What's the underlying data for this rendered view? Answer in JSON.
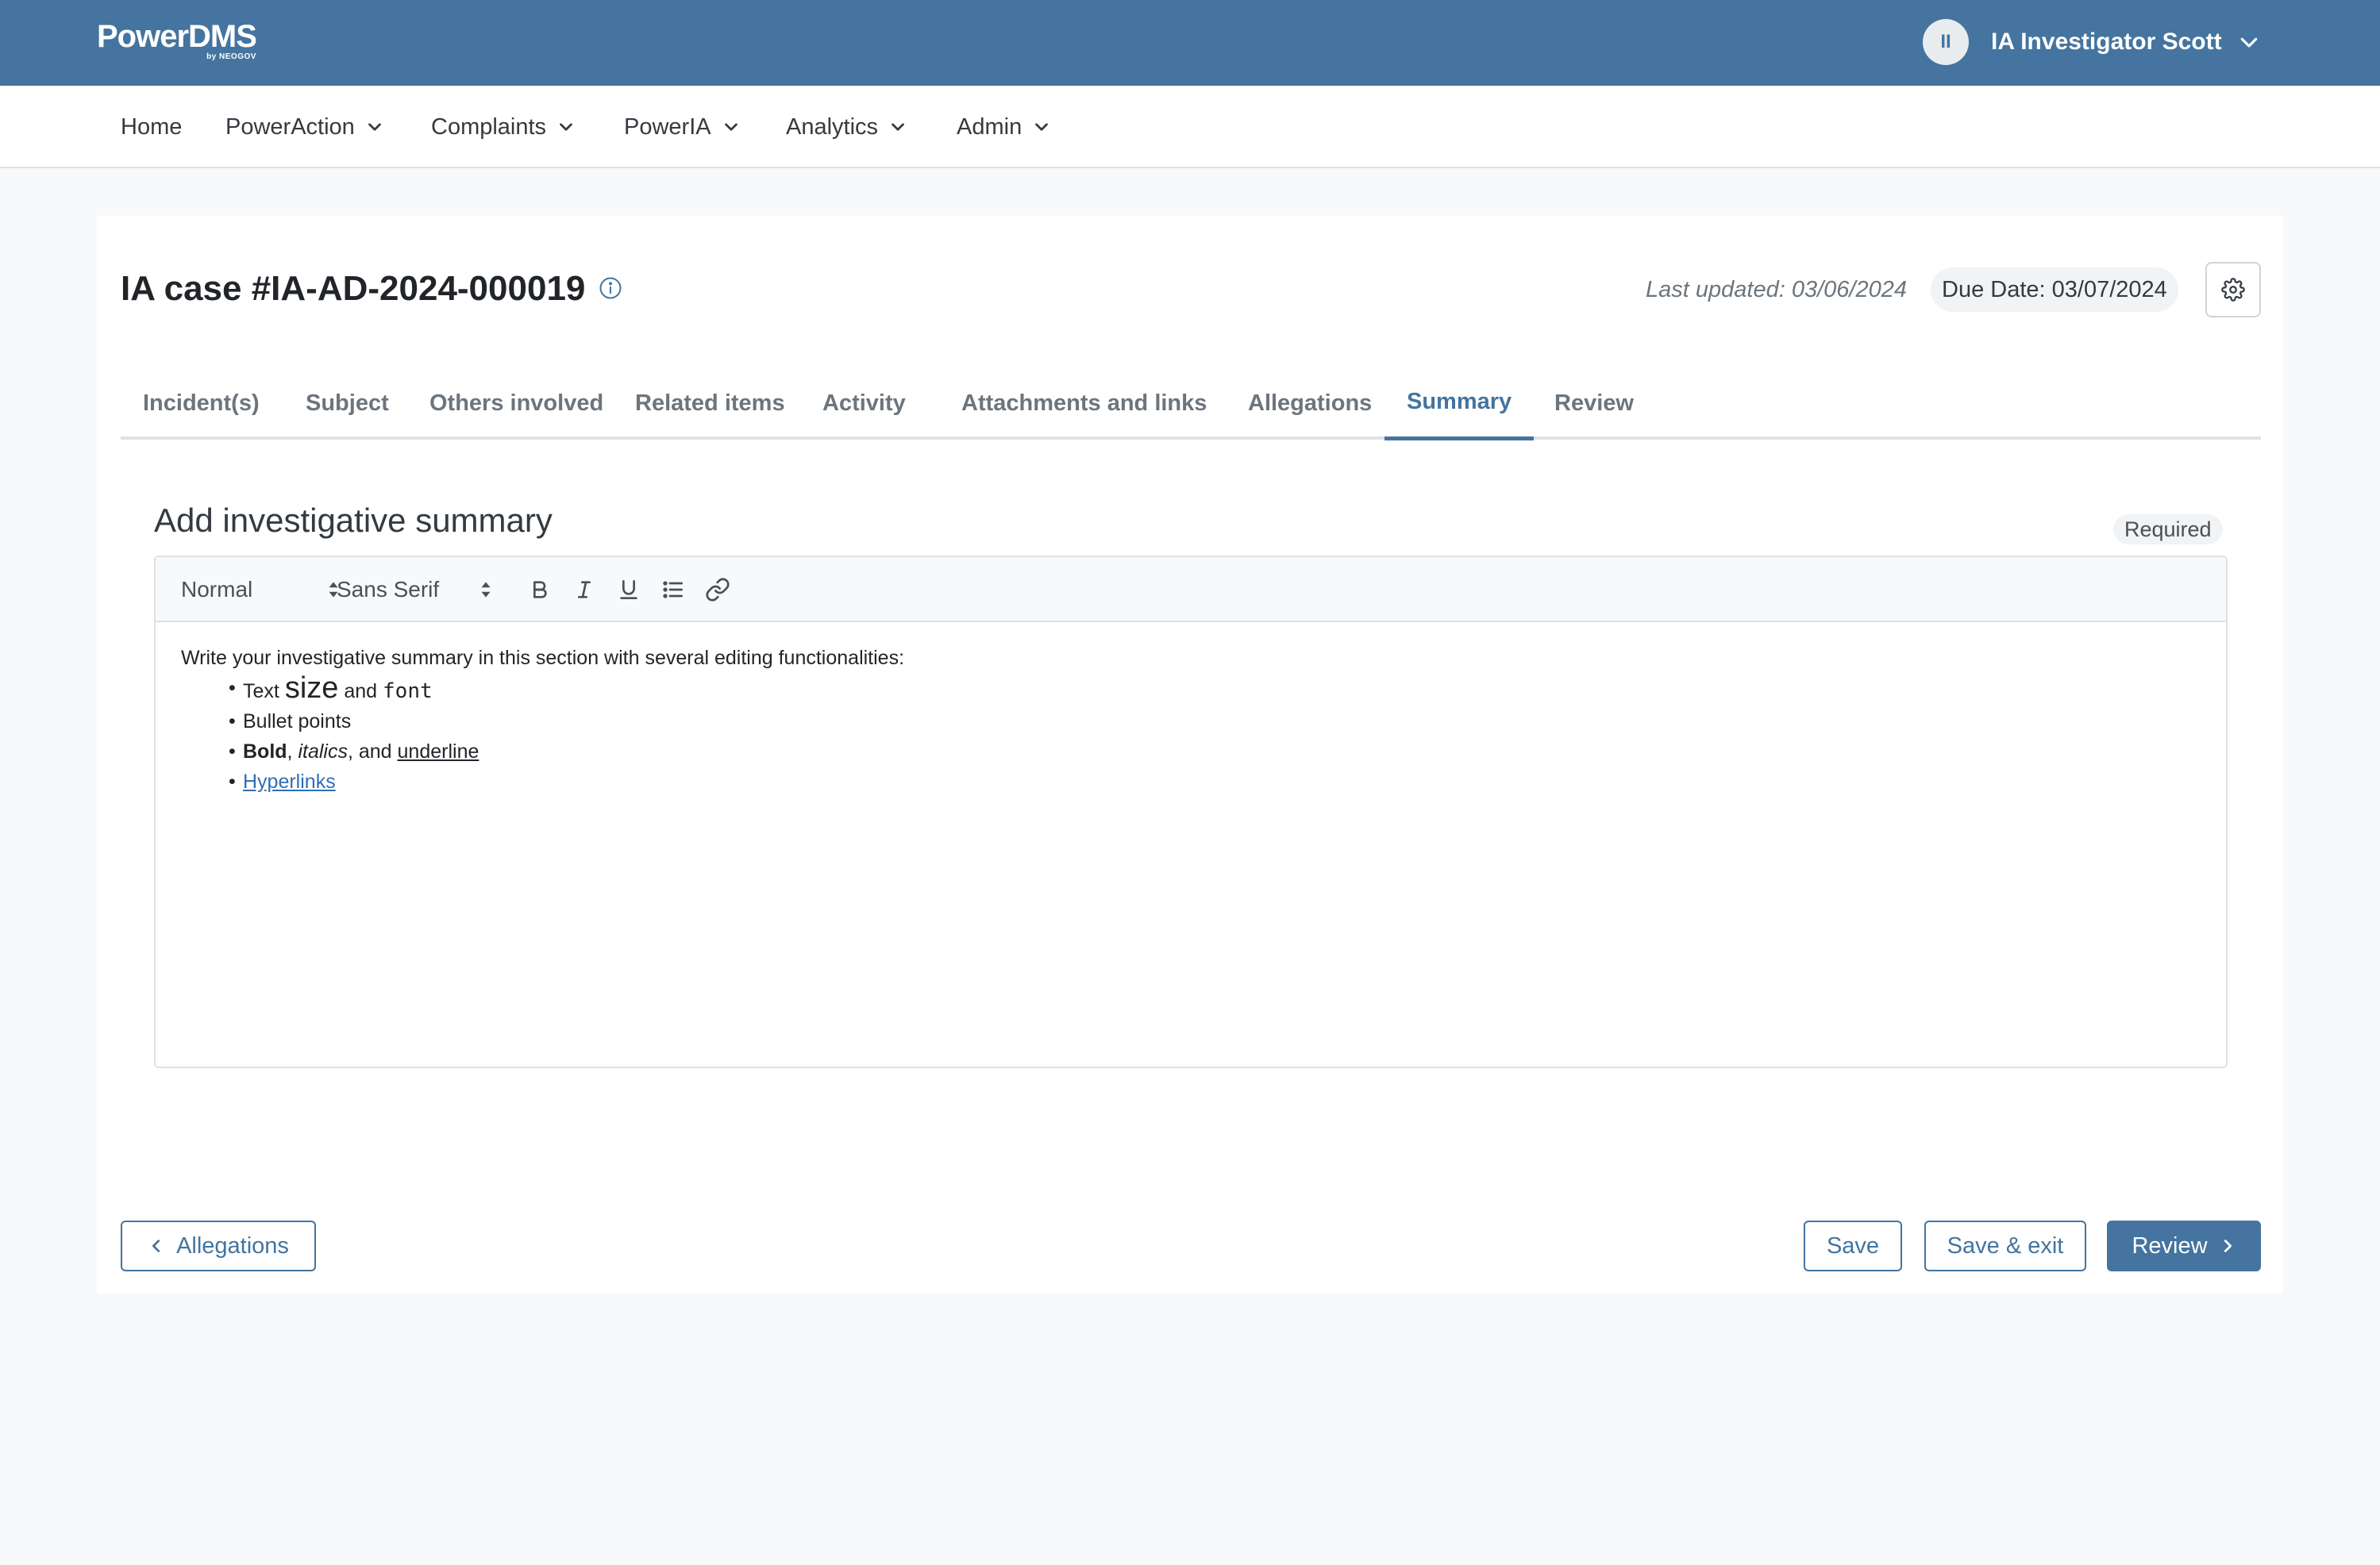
{
  "header": {
    "logo_main": "PowerDMS",
    "logo_sub": "by NEOGOV",
    "user_initials": "II",
    "user_name": "IA Investigator Scott"
  },
  "nav": {
    "items": [
      {
        "label": "Home"
      },
      {
        "label": "PowerAction"
      },
      {
        "label": "Complaints"
      },
      {
        "label": "PowerIA"
      },
      {
        "label": "Analytics"
      },
      {
        "label": "Admin"
      }
    ]
  },
  "case": {
    "title": "IA case #IA-AD-2024-000019",
    "last_updated": "Last updated: 03/06/2024",
    "due_date": "Due Date: 03/07/2024"
  },
  "tabs": [
    {
      "label": "Incident(s)"
    },
    {
      "label": "Subject"
    },
    {
      "label": "Others involved"
    },
    {
      "label": "Related items"
    },
    {
      "label": "Activity"
    },
    {
      "label": "Attachments and links"
    },
    {
      "label": "Allegations"
    },
    {
      "label": "Summary"
    },
    {
      "label": "Review"
    }
  ],
  "summary": {
    "title": "Add investigative summary",
    "required": "Required",
    "toolbar": {
      "size_select": "Normal",
      "font_select": "Sans Serif"
    },
    "content": {
      "intro": "Write your investigative summary in this section with several editing functionalities:",
      "b1_text": "Text",
      "b1_size": "size",
      "b1_and": "and",
      "b1_font": "font",
      "b2": "Bullet points",
      "b3_bold": "Bold",
      "b3_comma1": ",",
      "b3_italics": "italics",
      "b3_and": ", and",
      "b3_underline": "underline",
      "b4_link": "Hyperlinks"
    }
  },
  "footer": {
    "back_label": "Allegations",
    "save_label": "Save",
    "save_exit_label": "Save & exit",
    "review_label": "Review"
  },
  "colors": {
    "brand": "#44749f",
    "background": "#f8f9fa",
    "link": "#2f6fb3"
  }
}
